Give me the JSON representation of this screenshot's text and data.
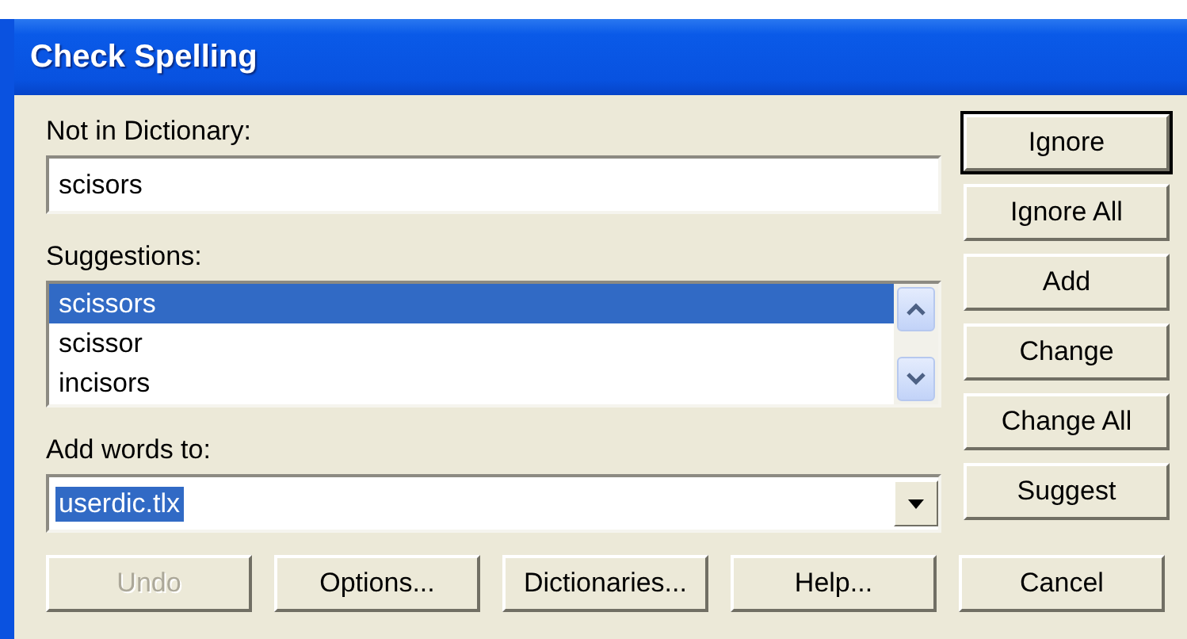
{
  "window": {
    "title": "Check Spelling"
  },
  "not_in_dictionary": {
    "label": "Not in Dictionary:",
    "value": "scisors"
  },
  "suggestions": {
    "label": "Suggestions:",
    "items": [
      {
        "text": "scissors",
        "selected": true
      },
      {
        "text": "scissor",
        "selected": false
      },
      {
        "text": "incisors",
        "selected": false
      }
    ]
  },
  "add_words_to": {
    "label": "Add words to:",
    "value": "userdic.tlx",
    "value_selected": true
  },
  "side_buttons": [
    {
      "label": "Ignore",
      "default": true,
      "disabled": false
    },
    {
      "label": "Ignore All",
      "disabled": false,
      "default": false
    },
    {
      "label": "Add",
      "disabled": false,
      "default": false
    },
    {
      "label": "Change",
      "disabled": false,
      "default": false
    },
    {
      "label": "Change All",
      "disabled": false,
      "default": false
    },
    {
      "label": "Suggest",
      "disabled": false,
      "default": false
    }
  ],
  "bottom_buttons": [
    {
      "label": "Undo",
      "disabled": true
    },
    {
      "label": "Options...",
      "disabled": false
    },
    {
      "label": "Dictionaries...",
      "disabled": false
    },
    {
      "label": "Help...",
      "disabled": false
    },
    {
      "label": "Cancel",
      "disabled": false
    }
  ]
}
